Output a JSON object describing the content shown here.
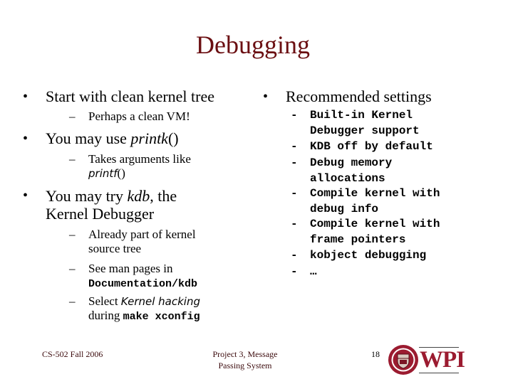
{
  "slide": {
    "title": "Debugging",
    "left_column": {
      "items": [
        {
          "text": "Start with clean kernel tree",
          "sub": [
            {
              "text": "Perhaps a clean VM!"
            }
          ]
        },
        {
          "text_before": "You may use ",
          "text_italic": "printk",
          "text_after": "()",
          "sub": [
            {
              "line1": "Takes arguments like",
              "line2_italic": "printf",
              "line2_after": "()"
            }
          ]
        },
        {
          "line1_before": "You may try ",
          "line1_italic": "kdb",
          "line1_after": ", the",
          "line2": "Kernel Debugger",
          "sub": [
            {
              "line1": "Already part of kernel",
              "line2": "source tree"
            },
            {
              "line1": "See man pages in",
              "line2_mono": "Documentation/kdb"
            },
            {
              "line1_before": "Select ",
              "line1_italic": "Kernel hacking",
              "line2_before": "during ",
              "line2_mono": "make xconfig"
            }
          ]
        }
      ]
    },
    "right_column": {
      "heading": "Recommended settings",
      "settings": [
        {
          "line1": "Built-in Kernel",
          "line2": "Debugger support"
        },
        {
          "line1": "KDB off by default"
        },
        {
          "line1": "Debug memory",
          "line2": "allocations"
        },
        {
          "line1": "Compile kernel with",
          "line2": "debug info"
        },
        {
          "line1": "Compile kernel with",
          "line2": "frame pointers"
        },
        {
          "line1": "kobject debugging"
        },
        {
          "line1": "…"
        }
      ]
    },
    "bullet_glyph": "•",
    "dash_glyph": "–",
    "mono_dash_glyph": "-",
    "footer": {
      "course": "CS-502 Fall 2006",
      "project_line1": "Project 3, Message",
      "project_line2": "Passing System",
      "page_number": "18",
      "logo_text": "WPI"
    },
    "colors": {
      "title": "#6b0f12",
      "logo": "#9b1b30"
    }
  }
}
